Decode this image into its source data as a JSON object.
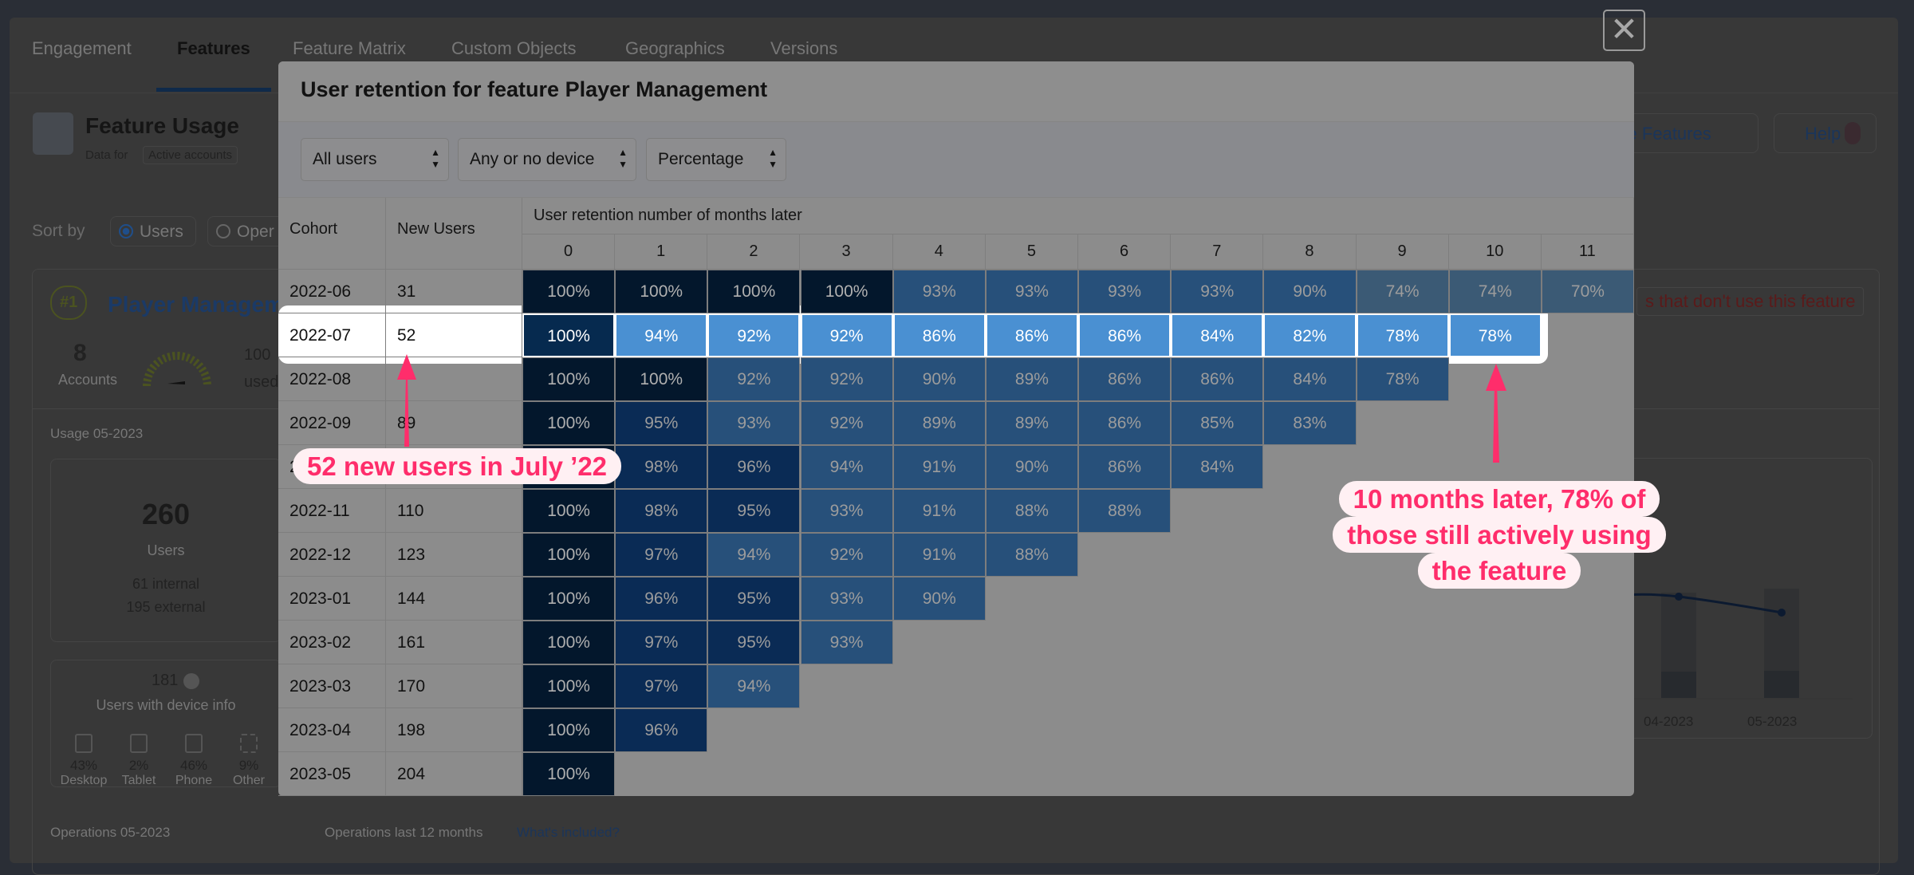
{
  "page": {
    "tabs": [
      "Engagement",
      "Features",
      "Feature Matrix",
      "Custom Objects",
      "Geographics",
      "Versions"
    ],
    "active_tab": "Features",
    "header": {
      "title": "Feature Usage",
      "data_for_label": "Data for",
      "data_for_value": "Active accounts"
    },
    "buttons": {
      "configure": "ure Features",
      "help": "Help"
    },
    "sort": {
      "label": "Sort by",
      "options": [
        "Users",
        "Oper"
      ],
      "selected": "Users"
    },
    "feature_card": {
      "rank": "#1",
      "name": "Player Managem",
      "accounts_value": "8",
      "accounts_label": "Accounts",
      "used_pct": "100",
      "used_label": "used",
      "warning": "s that don't use this feature",
      "usage_title": "Usage 05-2023",
      "users_value": "260",
      "users_label": "Users",
      "internal": "61 internal",
      "external": "195 external",
      "device_users_value": "181",
      "device_users_label": "Users with device info",
      "devices": [
        {
          "icon": "desktop-icon",
          "pct": "43%",
          "label": "Desktop"
        },
        {
          "icon": "tablet-icon",
          "pct": "2%",
          "label": "Tablet"
        },
        {
          "icon": "phone-icon",
          "pct": "46%",
          "label": "Phone"
        },
        {
          "icon": "other-device-icon",
          "pct": "9%",
          "label": "Other"
        }
      ],
      "operations_title": "Operations 05-2023",
      "operations_12m": "Operations last 12 months",
      "whats_included": "What's included?",
      "chart_labels": [
        "04-2023",
        "05-2023"
      ]
    }
  },
  "modal": {
    "title": "User retention for feature Player Management",
    "filters": [
      {
        "name": "user-type-select",
        "value": "All users"
      },
      {
        "name": "device-select",
        "value": "Any or no device"
      },
      {
        "name": "display-mode-select",
        "value": "Percentage"
      }
    ],
    "table": {
      "cohort_header": "Cohort",
      "new_users_header": "New Users",
      "retention_header": "User retention number of months later",
      "months": [
        "0",
        "1",
        "2",
        "3",
        "4",
        "5",
        "6",
        "7",
        "8",
        "9",
        "10",
        "11"
      ],
      "highlight_cohort": "2022-07",
      "rows": [
        {
          "cohort": "2022-06",
          "new_users": "31",
          "values": [
            100,
            100,
            100,
            100,
            93,
            93,
            93,
            93,
            90,
            74,
            74,
            70
          ]
        },
        {
          "cohort": "2022-07",
          "new_users": "52",
          "values": [
            100,
            94,
            92,
            92,
            86,
            86,
            86,
            84,
            82,
            78,
            78
          ]
        },
        {
          "cohort": "2022-08",
          "new_users": "",
          "values": [
            100,
            100,
            92,
            92,
            90,
            89,
            86,
            86,
            84,
            78
          ]
        },
        {
          "cohort": "2022-09",
          "new_users": "89",
          "values": [
            100,
            95,
            93,
            92,
            89,
            89,
            86,
            85,
            83
          ]
        },
        {
          "cohort": "2022-10",
          "new_users": "",
          "values": [
            100,
            98,
            96,
            94,
            91,
            90,
            86,
            84
          ]
        },
        {
          "cohort": "2022-11",
          "new_users": "110",
          "values": [
            100,
            98,
            95,
            93,
            91,
            88,
            88
          ]
        },
        {
          "cohort": "2022-12",
          "new_users": "123",
          "values": [
            100,
            97,
            94,
            92,
            91,
            88
          ]
        },
        {
          "cohort": "2023-01",
          "new_users": "144",
          "values": [
            100,
            96,
            95,
            93,
            90
          ]
        },
        {
          "cohort": "2023-02",
          "new_users": "161",
          "values": [
            100,
            97,
            95,
            93
          ]
        },
        {
          "cohort": "2023-03",
          "new_users": "170",
          "values": [
            100,
            97,
            94
          ]
        },
        {
          "cohort": "2023-04",
          "new_users": "198",
          "values": [
            100,
            96
          ]
        },
        {
          "cohort": "2023-05",
          "new_users": "204",
          "values": [
            100
          ]
        }
      ]
    }
  },
  "annotations": {
    "left": "52 new users in July ’22",
    "right_lines": [
      "10 months later, 78% of",
      "those still actively using",
      "the feature"
    ]
  },
  "colors": {
    "annotation": "#ff2d6b",
    "cell_100": "#03172c",
    "cell_95": "#0a2b55",
    "cell_mid": "#27507a",
    "cell_low": "#3b5a75",
    "highlight_cell": "#4a90d2",
    "highlight_first": "#062a4f"
  }
}
